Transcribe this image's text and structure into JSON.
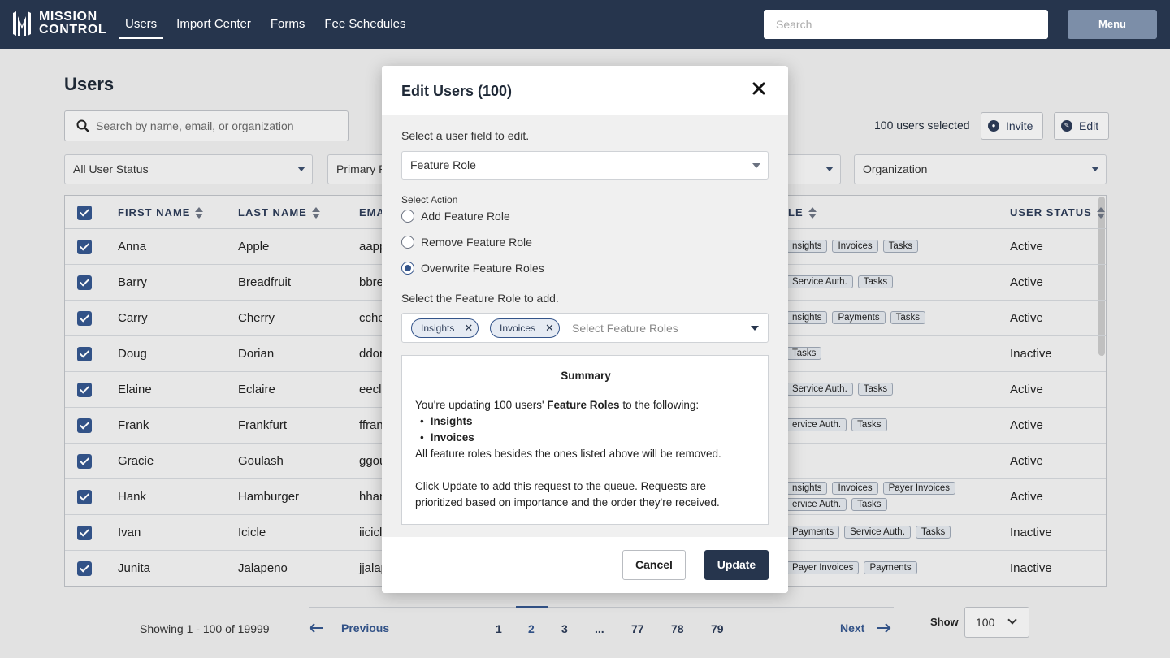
{
  "nav": {
    "logo_line1": "MISSION",
    "logo_line2": "CONTROL",
    "links": [
      {
        "label": "Users"
      },
      {
        "label": "Import Center"
      },
      {
        "label": "Forms"
      },
      {
        "label": "Fee Schedules"
      }
    ],
    "search_placeholder": "Search",
    "menu_label": "Menu"
  },
  "page": {
    "title": "Users",
    "search_placeholder": "Search by name, email, or organization",
    "selected_count": "100 users selected",
    "invite_label": "Invite",
    "edit_label": "Edit",
    "filters": {
      "status": "All User Status",
      "primary_role": "Primary R",
      "organization": "Organization"
    }
  },
  "table": {
    "headers": {
      "first_name": "FIRST NAME",
      "last_name": "LAST NAME",
      "email": "EMA",
      "feature_role": "LE",
      "user_status": "USER STATUS"
    },
    "rows": [
      {
        "first": "Anna",
        "last": "Apple",
        "email": "aapp",
        "tags": [
          "nsights",
          "Invoices",
          "Tasks"
        ],
        "status": "Active"
      },
      {
        "first": "Barry",
        "last": "Breadfruit",
        "email": "bbre",
        "tags": [
          "Service Auth.",
          "Tasks"
        ],
        "status": "Active"
      },
      {
        "first": "Carry",
        "last": "Cherry",
        "email": "cche",
        "tags": [
          "nsights",
          "Payments",
          "Tasks"
        ],
        "status": "Active"
      },
      {
        "first": "Doug",
        "last": "Dorian",
        "email": "ddor",
        "tags": [
          "Tasks"
        ],
        "status": "Inactive"
      },
      {
        "first": "Elaine",
        "last": "Eclaire",
        "email": "eecla",
        "tags": [
          "Service Auth.",
          "Tasks"
        ],
        "status": "Active"
      },
      {
        "first": "Frank",
        "last": "Frankfurt",
        "email": "ffran",
        "tags": [
          "ervice Auth.",
          "Tasks"
        ],
        "status": "Active"
      },
      {
        "first": "Gracie",
        "last": "Goulash",
        "email": "ggou",
        "tags": [],
        "status": "Active"
      },
      {
        "first": "Hank",
        "last": "Hamburger",
        "email": "hhan",
        "tags": [
          "nsights",
          "Invoices",
          "Payer Invoices",
          "ervice Auth.",
          "Tasks"
        ],
        "status": "Active"
      },
      {
        "first": "Ivan",
        "last": "Icicle",
        "email": "iicicl",
        "tags": [
          "Payments",
          "Service Auth.",
          "Tasks"
        ],
        "status": "Inactive"
      },
      {
        "first": "Junita",
        "last": "Jalapeno",
        "email": "jjalap",
        "tags": [
          "Payer Invoices",
          "Payments"
        ],
        "status": "Inactive"
      }
    ]
  },
  "pagination": {
    "showing": "Showing 1 - 100 of 19999",
    "previous": "Previous",
    "next": "Next",
    "pages": [
      "1",
      "2",
      "3",
      "...",
      "77",
      "78",
      "79"
    ],
    "current_page": "2",
    "show_label": "Show",
    "show_value": "100"
  },
  "modal": {
    "title": "Edit Users (100)",
    "field_prompt": "Select a user field to edit.",
    "field_value": "Feature Role",
    "action_label": "Select Action",
    "actions": [
      {
        "label": "Add Feature Role",
        "checked": false
      },
      {
        "label": "Remove Feature Role",
        "checked": false
      },
      {
        "label": "Overwrite Feature Roles",
        "checked": true
      }
    ],
    "roles_prompt": "Select the Feature Role to add.",
    "chips": [
      "Insights",
      "Invoices"
    ],
    "roles_placeholder": "Select Feature Roles",
    "summary": {
      "title": "Summary",
      "intro_pre": "You're updating 100 users' ",
      "intro_bold": "Feature Roles",
      "intro_post": " to the following:",
      "items": [
        "Insights",
        "Invoices"
      ],
      "note": "All feature roles besides the ones listed above will be removed.",
      "queue_line1": "Click Update to add this request to the queue. Requests are",
      "queue_line2": "prioritized based on importance and the order they're received."
    },
    "cancel_label": "Cancel",
    "update_label": "Update"
  },
  "colors": {
    "nav_bg": "#26354d",
    "accent": "#34548a",
    "primary_button": "#26354d"
  }
}
